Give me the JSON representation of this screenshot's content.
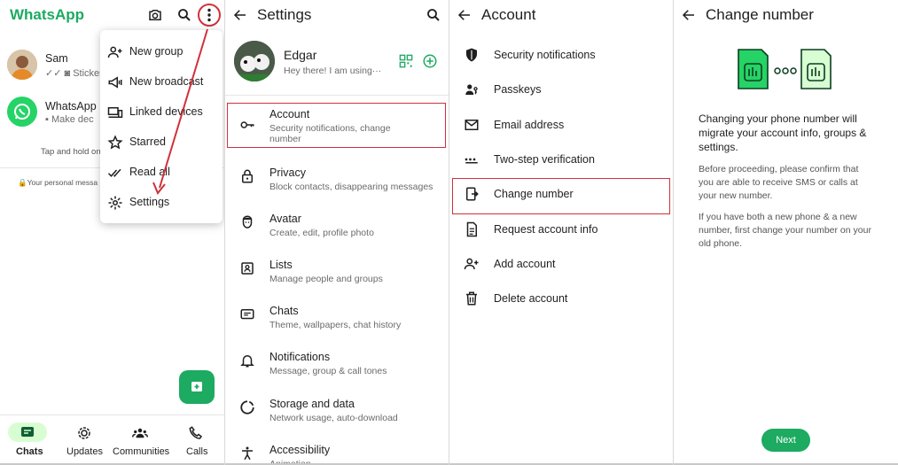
{
  "colors": {
    "brand": "#1daa61",
    "highlight": "#d0313b",
    "fab": "#1daa61",
    "tabActive": "#d8fdd2"
  },
  "chats_screen": {
    "app_title": "WhatsApp",
    "chats": [
      {
        "name": "Sam",
        "preview": "Sticker"
      },
      {
        "name": "WhatsApp",
        "preview": "Make dec"
      }
    ],
    "hint": "Tap and hold on",
    "personal_note": "Your personal messa",
    "menu": [
      "New group",
      "New broadcast",
      "Linked devices",
      "Starred",
      "Read all",
      "Settings"
    ],
    "tabs": [
      "Chats",
      "Updates",
      "Communities",
      "Calls"
    ]
  },
  "settings_screen": {
    "title": "Settings",
    "profile": {
      "name": "Edgar",
      "status": "Hey there! I am using···"
    },
    "items": [
      {
        "title": "Account",
        "sub": "Security notifications, change number",
        "icon": "key-icon"
      },
      {
        "title": "Privacy",
        "sub": "Block contacts, disappearing messages",
        "icon": "lock-icon"
      },
      {
        "title": "Avatar",
        "sub": "Create, edit, profile photo",
        "icon": "avatar-icon"
      },
      {
        "title": "Lists",
        "sub": "Manage people and groups",
        "icon": "lists-icon"
      },
      {
        "title": "Chats",
        "sub": "Theme, wallpapers, chat history",
        "icon": "chat-icon"
      },
      {
        "title": "Notifications",
        "sub": "Message, group & call tones",
        "icon": "bell-icon"
      },
      {
        "title": "Storage and data",
        "sub": "Network usage, auto-download",
        "icon": "storage-icon"
      },
      {
        "title": "Accessibility",
        "sub": "Animation",
        "icon": "accessibility-icon"
      }
    ]
  },
  "account_screen": {
    "title": "Account",
    "items": [
      "Security notifications",
      "Passkeys",
      "Email address",
      "Two-step verification",
      "Change number",
      "Request account info",
      "Add account",
      "Delete account"
    ]
  },
  "change_number_screen": {
    "title": "Change number",
    "lead": "Changing your phone number will migrate your account info, groups & settings.",
    "para1": "Before proceeding, please confirm that you are able to receive SMS or calls at your new number.",
    "para2": "If you have both a new phone & a new number, first change your number on your old phone.",
    "next": "Next"
  }
}
